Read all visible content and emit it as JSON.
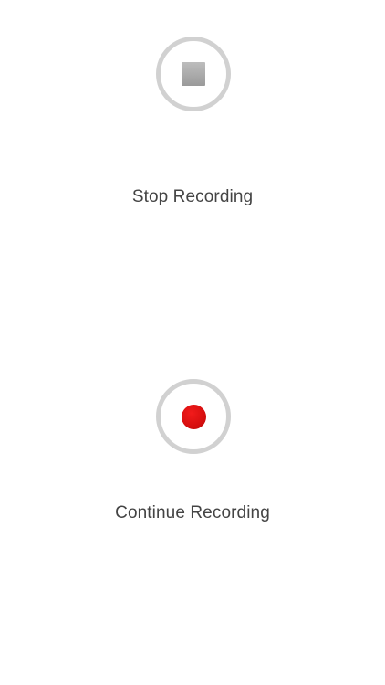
{
  "controls": {
    "stop": {
      "label": "Stop Recording",
      "icon": "stop-square-icon"
    },
    "continue": {
      "label": "Continue Recording",
      "icon": "record-dot-icon"
    }
  },
  "colors": {
    "background": "#ffffff",
    "ring": "#d1d1d1",
    "stop_icon": "#a8a8a8",
    "record_icon": "#e01414",
    "label_text": "#444444"
  }
}
